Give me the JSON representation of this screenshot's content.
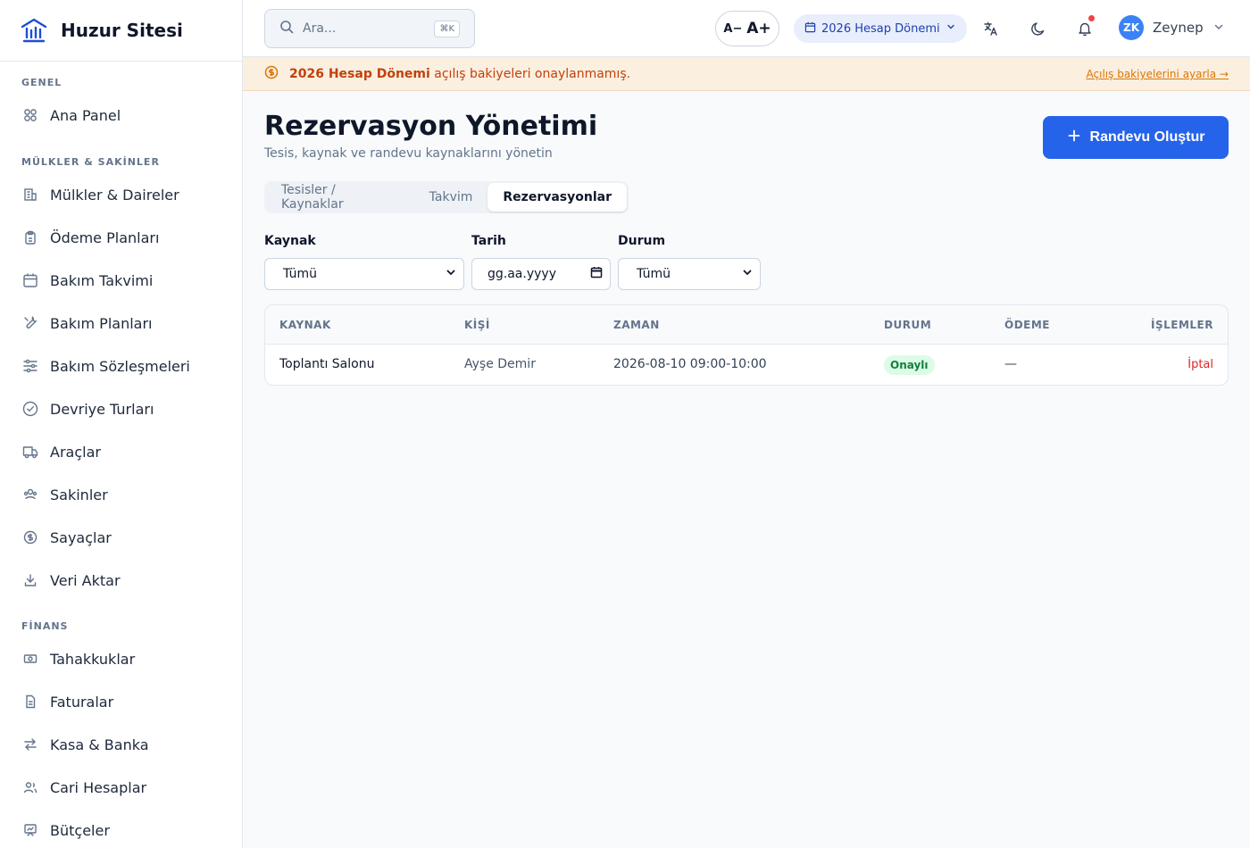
{
  "brand": {
    "name": "Huzur Sitesi"
  },
  "sidebar": {
    "sections": [
      {
        "title": "GENEL",
        "items": [
          {
            "label": "Ana Panel",
            "icon": "dashboard-icon"
          }
        ]
      },
      {
        "title": "MÜLKLER & SAKİNLER",
        "items": [
          {
            "label": "Mülkler & Daireler",
            "icon": "building-icon"
          },
          {
            "label": "Ödeme Planları",
            "icon": "clipboard-icon"
          },
          {
            "label": "Bakım Takvimi",
            "icon": "calendar-icon"
          },
          {
            "label": "Bakım Planları",
            "icon": "wrench-icon"
          },
          {
            "label": "Bakım Sözleşmeleri",
            "icon": "sliders-icon"
          },
          {
            "label": "Devriye Turları",
            "icon": "check-circle-icon"
          },
          {
            "label": "Araçlar",
            "icon": "truck-icon"
          },
          {
            "label": "Sakinler",
            "icon": "users-icon"
          },
          {
            "label": "Sayaçlar",
            "icon": "dollar-circle-icon"
          },
          {
            "label": "Veri Aktar",
            "icon": "download-icon"
          }
        ]
      },
      {
        "title": "FİNANS",
        "items": [
          {
            "label": "Tahakkuklar",
            "icon": "banknote-icon"
          },
          {
            "label": "Faturalar",
            "icon": "file-icon"
          },
          {
            "label": "Kasa & Banka",
            "icon": "transfer-icon"
          },
          {
            "label": "Cari Hesaplar",
            "icon": "contacts-icon"
          },
          {
            "label": "Bütçeler",
            "icon": "presentation-icon"
          }
        ]
      }
    ]
  },
  "topbar": {
    "search_placeholder": "Ara...",
    "search_shortcut": "⌘K",
    "font_decrease": "A−",
    "font_increase": "A+",
    "period": "2026 Hesap Dönemi",
    "user_initials": "ZK",
    "user_name": "Zeynep"
  },
  "banner": {
    "bold": "2026 Hesap Dönemi",
    "text": " açılış bakiyeleri onaylanmamış.",
    "link": "Açılış bakiyelerini ayarla →"
  },
  "page": {
    "title": "Rezervasyon Yönetimi",
    "subtitle": "Tesis, kaynak ve randevu kaynaklarını yönetin",
    "create_button": "Randevu Oluştur"
  },
  "tabs": [
    "Tesisler / Kaynaklar",
    "Takvim",
    "Rezervasyonlar"
  ],
  "active_tab": 2,
  "filters": {
    "resource": {
      "label": "Kaynak",
      "value": "Tümü"
    },
    "date": {
      "label": "Tarih",
      "placeholder": "gg.aa.yyyy"
    },
    "status": {
      "label": "Durum",
      "value": "Tümü"
    }
  },
  "table": {
    "headers": [
      "KAYNAK",
      "KİŞİ",
      "ZAMAN",
      "DURUM",
      "ÖDEME",
      "İŞLEMLER"
    ],
    "rows": [
      {
        "resource": "Toplantı Salonu",
        "person": "Ayşe Demir",
        "time": "2026-08-10 09:00-10:00",
        "status": "Onaylı",
        "payment": "—",
        "action": "İptal"
      }
    ]
  },
  "colors": {
    "primary": "#2563eb",
    "banner_bg": "#fbefdf",
    "banner_text": "#c2410c",
    "success_bg": "#dcfce7",
    "success_text": "#15803d",
    "danger": "#dc2626"
  }
}
